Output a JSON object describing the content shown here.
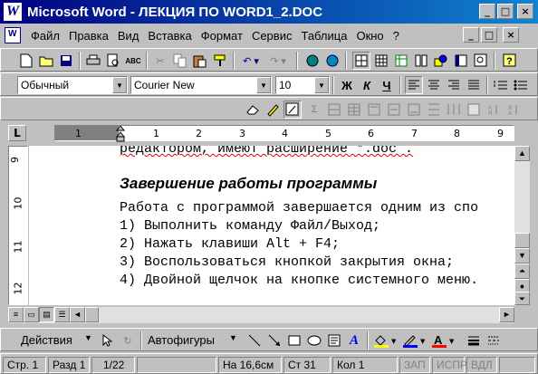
{
  "window": {
    "title": "Microsoft Word - ЛЕКЦИЯ ПО WORD1_2.DOC",
    "controls": [
      "_",
      "□",
      "×"
    ]
  },
  "menu": {
    "items": [
      "Файл",
      "Правка",
      "Вид",
      "Вставка",
      "Формат",
      "Сервис",
      "Таблица",
      "Окно",
      "?"
    ]
  },
  "formatting": {
    "style": "Обычный",
    "font": "Courier New",
    "size": "10",
    "bold": "Ж",
    "italic": "К",
    "underline": "Ч"
  },
  "ruler": {
    "unit_box": "L",
    "numbers": [
      "1",
      "1",
      "2",
      "3",
      "4",
      "5",
      "6",
      "7",
      "8",
      "9"
    ]
  },
  "vertical_ruler": {
    "numbers": [
      "9",
      "10",
      "11",
      "12"
    ]
  },
  "document": {
    "prev_line": "редактором, имеют расширение *.doc .",
    "heading": "Завершение работы программы",
    "lines": [
      "Работа с программой завершается одним из спо",
      "1) Выполнить команду Файл/Выход;",
      "2) Нажать клавиши Alt + F4;",
      "3) Воспользоваться кнопкой закрытия окна;",
      "4) Двойной щелчок на кнопке системного меню."
    ]
  },
  "drawing": {
    "actions": "Действия",
    "autoshapes": "Автофигуры"
  },
  "status": {
    "page": "Стр. 1",
    "section": "Разд 1",
    "pages": "1/22",
    "position": "На 16,6см",
    "line": "Ст 31",
    "column": "Кол 1",
    "rec": "ЗАП",
    "trk": "ИСПР",
    "ext": "ВДЛ"
  }
}
